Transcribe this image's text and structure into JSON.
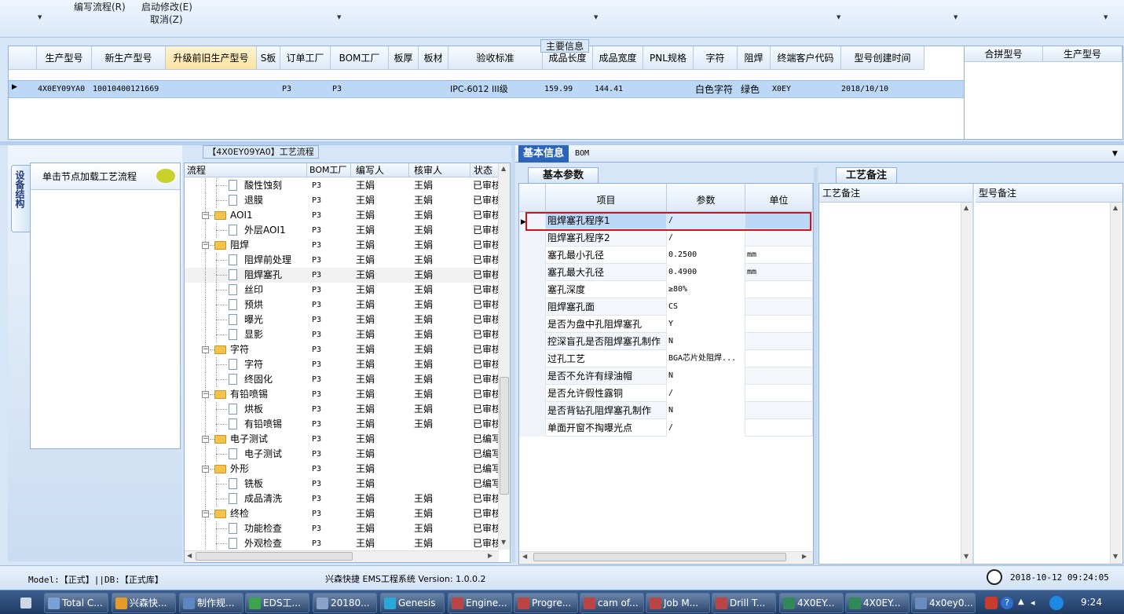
{
  "toolbar": {
    "items": [
      "编写流程(R)",
      "启动修改(E)",
      "取消(Z)"
    ]
  },
  "main_info": {
    "title": "主要信息",
    "columns": [
      "生产型号",
      "新生产型号",
      "升级前旧生产型号",
      "S板",
      "订单工厂",
      "BOM工厂",
      "板厚",
      "板材",
      "验收标准",
      "成品长度",
      "成品宽度",
      "PNL规格",
      "字符",
      "阻焊",
      "终端客户代码",
      "型号创建时间"
    ],
    "row": [
      "4X0EY09YA0",
      "10010400121669",
      "",
      "",
      "P3",
      "P3",
      "",
      "",
      "IPC-6012 III级",
      "159.99",
      "144.41",
      "",
      "白色字符",
      "绿色",
      "X0EY",
      "2018/10/10"
    ],
    "side_columns": [
      "合拼型号",
      "生产型号"
    ]
  },
  "process": {
    "title": "【4X0EY09YA0】工艺流程",
    "side_tab": "设备结构",
    "tip": "单击节点加载工艺流程",
    "columns": [
      "流程",
      "BOM工厂",
      "编写人",
      "核审人",
      "状态"
    ],
    "rows": [
      {
        "level": 2,
        "name": "酸性蚀刻",
        "bom": "P3",
        "writer": "王娟",
        "reviewer": "王娟",
        "status": "已审核"
      },
      {
        "level": 2,
        "name": "退膜",
        "bom": "P3",
        "writer": "王娟",
        "reviewer": "王娟",
        "status": "已审核"
      },
      {
        "level": 1,
        "name": "AOI1",
        "bom": "P3",
        "writer": "王娟",
        "reviewer": "王娟",
        "status": "已审核"
      },
      {
        "level": 2,
        "name": "外层AOI1",
        "bom": "P3",
        "writer": "王娟",
        "reviewer": "王娟",
        "status": "已审核"
      },
      {
        "level": 1,
        "name": "阻焊",
        "bom": "P3",
        "writer": "王娟",
        "reviewer": "王娟",
        "status": "已审核"
      },
      {
        "level": 2,
        "name": "阻焊前处理",
        "bom": "P3",
        "writer": "王娟",
        "reviewer": "王娟",
        "status": "已审核"
      },
      {
        "level": 2,
        "name": "阻焊塞孔",
        "bom": "P3",
        "writer": "王娟",
        "reviewer": "王娟",
        "status": "已审核"
      },
      {
        "level": 2,
        "name": "丝印",
        "bom": "P3",
        "writer": "王娟",
        "reviewer": "王娟",
        "status": "已审核"
      },
      {
        "level": 2,
        "name": "预烘",
        "bom": "P3",
        "writer": "王娟",
        "reviewer": "王娟",
        "status": "已审核"
      },
      {
        "level": 2,
        "name": "曝光",
        "bom": "P3",
        "writer": "王娟",
        "reviewer": "王娟",
        "status": "已审核"
      },
      {
        "level": 2,
        "name": "显影",
        "bom": "P3",
        "writer": "王娟",
        "reviewer": "王娟",
        "status": "已审核"
      },
      {
        "level": 1,
        "name": "字符",
        "bom": "P3",
        "writer": "王娟",
        "reviewer": "王娟",
        "status": "已审核"
      },
      {
        "level": 2,
        "name": "字符",
        "bom": "P3",
        "writer": "王娟",
        "reviewer": "王娟",
        "status": "已审核"
      },
      {
        "level": 2,
        "name": "终固化",
        "bom": "P3",
        "writer": "王娟",
        "reviewer": "王娟",
        "status": "已审核"
      },
      {
        "level": 1,
        "name": "有铅喷锡",
        "bom": "P3",
        "writer": "王娟",
        "reviewer": "王娟",
        "status": "已审核"
      },
      {
        "level": 2,
        "name": "烘板",
        "bom": "P3",
        "writer": "王娟",
        "reviewer": "王娟",
        "status": "已审核"
      },
      {
        "level": 2,
        "name": "有铅喷锡",
        "bom": "P3",
        "writer": "王娟",
        "reviewer": "王娟",
        "status": "已审核"
      },
      {
        "level": 1,
        "name": "电子测试",
        "bom": "P3",
        "writer": "王娟",
        "reviewer": "",
        "status": "已编写"
      },
      {
        "level": 2,
        "name": "电子测试",
        "bom": "P3",
        "writer": "王娟",
        "reviewer": "",
        "status": "已编写"
      },
      {
        "level": 1,
        "name": "外形",
        "bom": "P3",
        "writer": "王娟",
        "reviewer": "",
        "status": "已编写"
      },
      {
        "level": 2,
        "name": "铣板",
        "bom": "P3",
        "writer": "王娟",
        "reviewer": "",
        "status": "已编写"
      },
      {
        "level": 2,
        "name": "成品清洗",
        "bom": "P3",
        "writer": "王娟",
        "reviewer": "王娟",
        "status": "已审核"
      },
      {
        "level": 1,
        "name": "终检",
        "bom": "P3",
        "writer": "王娟",
        "reviewer": "王娟",
        "status": "已审核"
      },
      {
        "level": 2,
        "name": "功能检查",
        "bom": "P3",
        "writer": "王娟",
        "reviewer": "王娟",
        "status": "已审核"
      },
      {
        "level": 2,
        "name": "外观检查",
        "bom": "P3",
        "writer": "王娟",
        "reviewer": "王娟",
        "status": "已审核"
      }
    ],
    "selected_row": 6
  },
  "right_tabs": [
    "基本信息",
    "BOM"
  ],
  "params": {
    "tab": "基本参数",
    "columns": [
      "项目",
      "参数",
      "单位"
    ],
    "rows": [
      [
        "阻焊塞孔程序1",
        "/",
        ""
      ],
      [
        "阻焊塞孔程序2",
        "/",
        ""
      ],
      [
        "塞孔最小孔径",
        "0.2500",
        "mm"
      ],
      [
        "塞孔最大孔径",
        "0.4900",
        "mm"
      ],
      [
        "塞孔深度",
        "≥80%",
        ""
      ],
      [
        "阻焊塞孔面",
        "CS",
        ""
      ],
      [
        "是否为盘中孔阻焊塞孔",
        "Y",
        ""
      ],
      [
        "控深盲孔是否阻焊塞孔制作",
        "N",
        ""
      ],
      [
        "过孔工艺",
        "BGA芯片处阻焊...",
        ""
      ],
      [
        "是否不允许有绿油帽",
        "N",
        ""
      ],
      [
        "是否允许假性露铜",
        "/",
        ""
      ],
      [
        "是否背钻孔阻焊塞孔制作",
        "N",
        ""
      ],
      [
        "单面开窗不掏曝光点",
        "/",
        ""
      ]
    ]
  },
  "notes": {
    "tab": "工艺备注",
    "columns": [
      "工艺备注",
      "型号备注"
    ]
  },
  "status": {
    "model": "Model:【正式】||DB:【正式库】",
    "app": "兴森快捷 EMS工程系统 Version: 1.0.0.2",
    "datetime": "2018-10-12 09:24:05"
  },
  "taskbar": {
    "items": [
      "Total C...",
      "兴森快...",
      "制作规...",
      "EDS工...",
      "20180...",
      "Genesis",
      "Engine...",
      "Progre...",
      "cam of...",
      "Job M...",
      "Drill T...",
      "4X0EY...",
      "4X0EY...",
      "4x0ey0..."
    ],
    "clock": "9:24"
  },
  "colors": {
    "accent": "#2b64b8",
    "highlight_border": "#d0141c",
    "selection": "#bcd8f6",
    "folder": "#f3c34a"
  }
}
